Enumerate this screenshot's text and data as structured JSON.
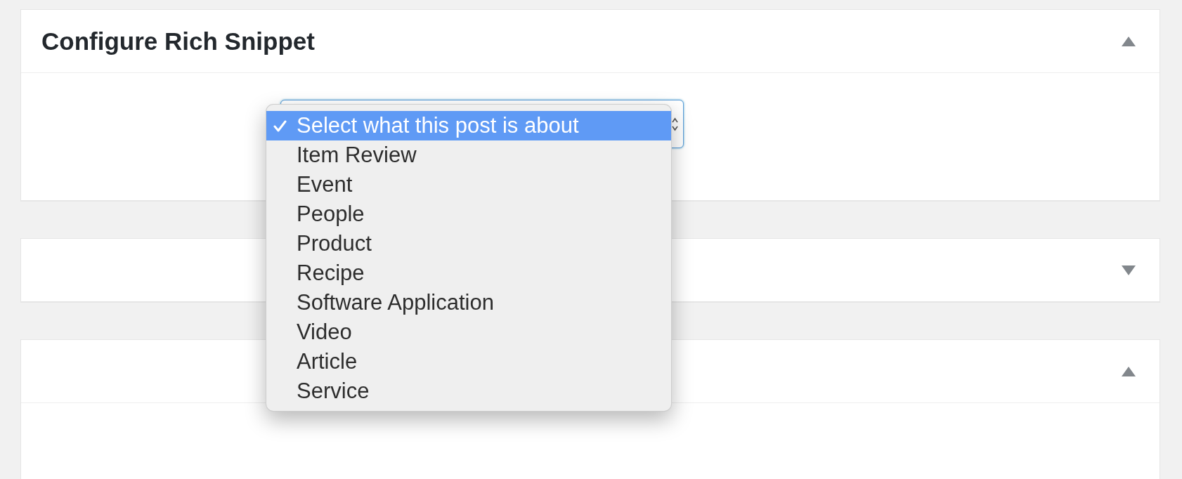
{
  "panels": [
    {
      "title": "Configure Rich Snippet",
      "expanded": true,
      "select": {
        "open": true,
        "options": [
          {
            "label": "Select what this post is about",
            "selected": true
          },
          {
            "label": "Item Review",
            "selected": false
          },
          {
            "label": "Event",
            "selected": false
          },
          {
            "label": "People",
            "selected": false
          },
          {
            "label": "Product",
            "selected": false
          },
          {
            "label": "Recipe",
            "selected": false
          },
          {
            "label": "Software Application",
            "selected": false
          },
          {
            "label": "Video",
            "selected": false
          },
          {
            "label": "Article",
            "selected": false
          },
          {
            "label": "Service",
            "selected": false
          }
        ]
      }
    },
    {
      "expanded": false
    },
    {
      "expanded": true
    }
  ]
}
